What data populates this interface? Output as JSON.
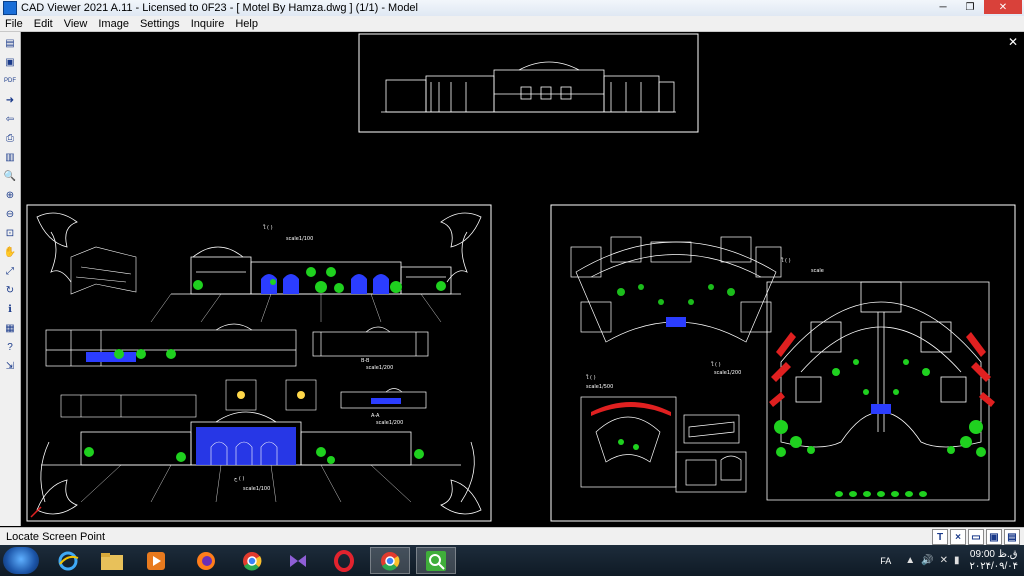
{
  "window": {
    "title": "CAD Viewer 2021 A.11 - Licensed to 0F23  -  [ Motel By Hamza.dwg ] (1/1)  -  Model",
    "controls": [
      "minimize",
      "restore",
      "close"
    ]
  },
  "menu": [
    "File",
    "Edit",
    "View",
    "Image",
    "Settings",
    "Inquire",
    "Help"
  ],
  "toolbar": [
    {
      "name": "open-icon",
      "glyph": "▤"
    },
    {
      "name": "save-icon",
      "glyph": "▣"
    },
    {
      "name": "pdf-icon",
      "glyph": "PDF"
    },
    {
      "name": "next-icon",
      "glyph": "➜"
    },
    {
      "name": "prev-icon",
      "glyph": "⇦"
    },
    {
      "name": "print-icon",
      "glyph": "⎙"
    },
    {
      "name": "layers-icon",
      "glyph": "▥"
    },
    {
      "name": "zoom-icon",
      "glyph": "🔍"
    },
    {
      "name": "zoom-in-icon",
      "glyph": "⊕"
    },
    {
      "name": "zoom-out-icon",
      "glyph": "⊖"
    },
    {
      "name": "zoom-window-icon",
      "glyph": "⊡"
    },
    {
      "name": "pan-icon",
      "glyph": "✋"
    },
    {
      "name": "fit-icon",
      "glyph": "⤢"
    },
    {
      "name": "rotate-icon",
      "glyph": "↻"
    },
    {
      "name": "info-icon",
      "glyph": "ℹ"
    },
    {
      "name": "book-icon",
      "glyph": "▦"
    },
    {
      "name": "help-icon",
      "glyph": "?"
    },
    {
      "name": "export-icon",
      "glyph": "⇲"
    }
  ],
  "drawing": {
    "labels": {
      "main_elev": "ใ ( ) ",
      "scale_a": "scale1/100",
      "sec_bb": "B-B ",
      "scale_b": "scale1/200",
      "sec_aa": "A-A ",
      "scale_c": "scale1/200",
      "main_front": "ج ( )",
      "scale_d": "scale1/100",
      "site_plan": "ใ ( ) ",
      "scale_e": "scale1/200",
      "plan_small": "ใ ( ) ",
      "scale_f": "scale1/500",
      "ground_plan": "ใ ( ) ",
      "scale_g": "scale"
    }
  },
  "status": {
    "text": "Locate Screen Point",
    "buttons": [
      "T",
      "×",
      "▭",
      "▣",
      "▤"
    ]
  },
  "taskbar": {
    "apps": [
      "file-explorer-icon",
      "ie-icon",
      "folder-icon",
      "media-player-icon",
      "firefox-icon",
      "chrome-icon",
      "vs-icon",
      "opera-icon",
      "chrome-profile-icon",
      "cad-viewer-icon"
    ],
    "lang": "FA",
    "time": "09:00 ق.ظ",
    "date": "۲۰۲۴/۰۹/۰۴"
  },
  "colors": {
    "accent": "#1a6ed8",
    "canvas": "#000000",
    "lines": "#ffffff",
    "green": "#1fd11f",
    "blue": "#2b3dff",
    "red": "#e02020"
  }
}
